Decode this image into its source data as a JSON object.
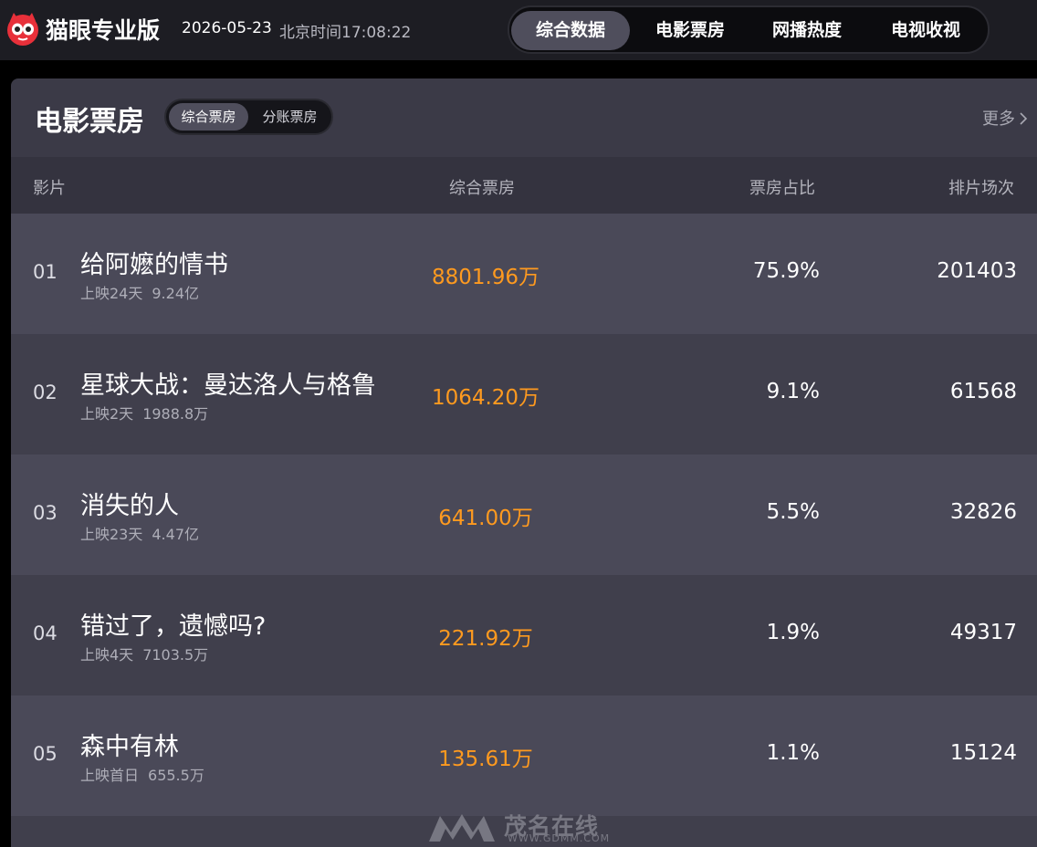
{
  "header": {
    "brand": "猫眼专业版",
    "date": "2026-05-23",
    "clock": "北京时间17:08:22",
    "nav": [
      {
        "label": "综合数据",
        "active": true
      },
      {
        "label": "电影票房",
        "active": false
      },
      {
        "label": "网播热度",
        "active": false
      },
      {
        "label": "电视收视",
        "active": false
      }
    ]
  },
  "card": {
    "title": "电影票房",
    "segments": [
      {
        "label": "综合票房",
        "active": true
      },
      {
        "label": "分账票房",
        "active": false
      }
    ],
    "more_label": "更多",
    "columns": {
      "film": "影片",
      "box_office": "综合票房",
      "share": "票房占比",
      "shows": "排片场次"
    },
    "rows": [
      {
        "rank": "01",
        "name": "给阿嬷的情书",
        "release": "上映24天",
        "total": "9.24亿",
        "box_office": "8801.96万",
        "share": "75.9%",
        "shows": "201403"
      },
      {
        "rank": "02",
        "name": "星球大战：曼达洛人与格鲁",
        "release": "上映2天",
        "total": "1988.8万",
        "box_office": "1064.20万",
        "share": "9.1%",
        "shows": "61568"
      },
      {
        "rank": "03",
        "name": "消失的人",
        "release": "上映23天",
        "total": "4.47亿",
        "box_office": "641.00万",
        "share": "5.5%",
        "shows": "32826"
      },
      {
        "rank": "04",
        "name": "错过了，遗憾吗?",
        "release": "上映4天",
        "total": "7103.5万",
        "box_office": "221.92万",
        "share": "1.9%",
        "shows": "49317"
      },
      {
        "rank": "05",
        "name": "森中有林",
        "release": "上映首日",
        "total": "655.5万",
        "box_office": "135.61万",
        "share": "1.1%",
        "shows": "15124"
      }
    ]
  },
  "watermark": {
    "text": "茂名在线",
    "url": "WWW.GDMM.COM"
  },
  "colors": {
    "accent_orange": "#ff9a1f",
    "brand_red": "#e8303a"
  }
}
